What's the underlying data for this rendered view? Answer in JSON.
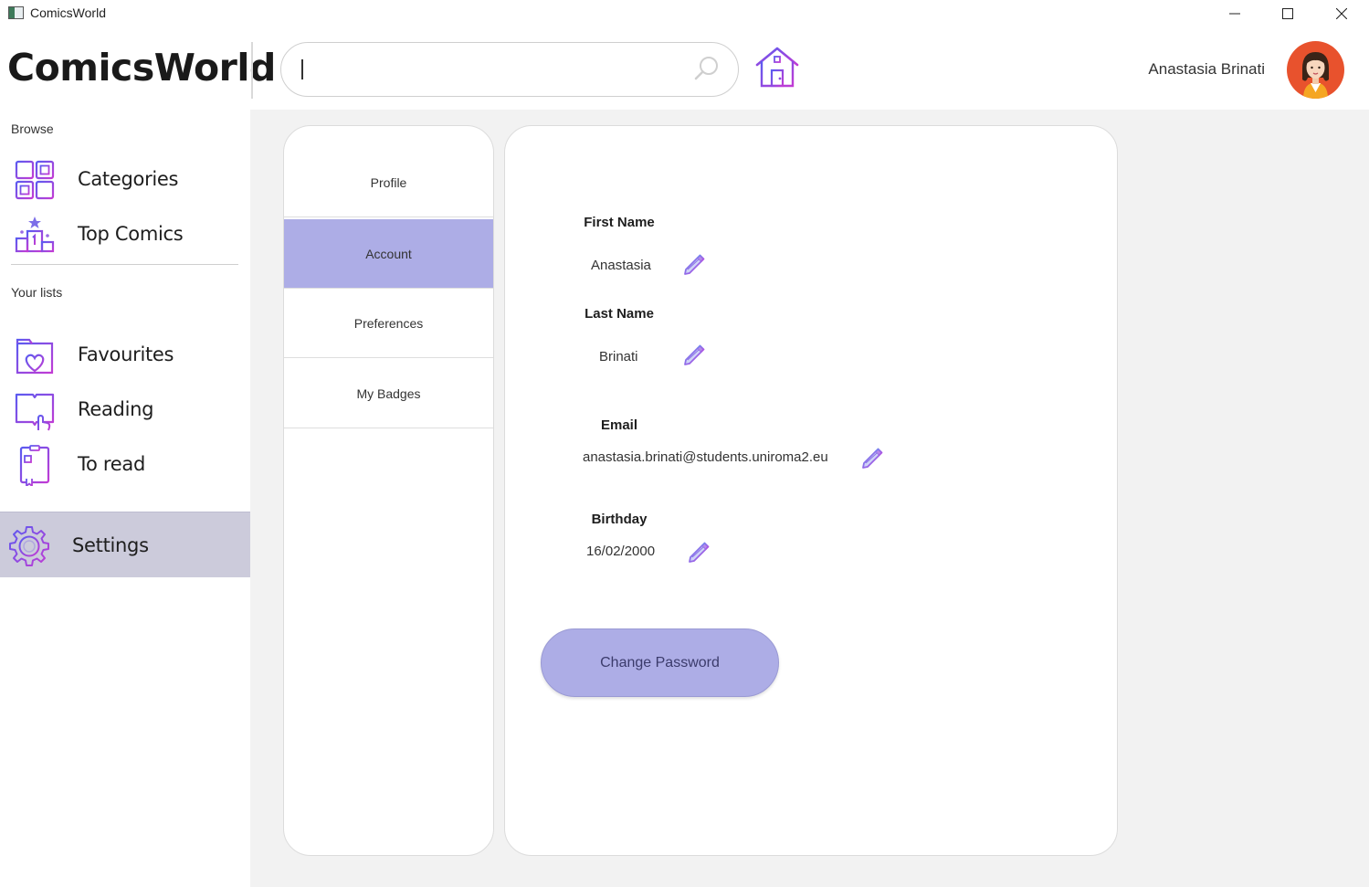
{
  "window": {
    "title": "ComicsWorld"
  },
  "header": {
    "brand": "ComicsWorld",
    "search": {
      "value": "",
      "placeholder": ""
    },
    "user_name": "Anastasia Brinati"
  },
  "sidebar": {
    "browse_label": "Browse",
    "browse_items": [
      {
        "label": "Categories",
        "icon": "categories-icon"
      },
      {
        "label": "Top Comics",
        "icon": "podium-icon"
      }
    ],
    "lists_label": "Your lists",
    "list_items": [
      {
        "label": "Favourites",
        "icon": "heart-folder-icon"
      },
      {
        "label": "Reading",
        "icon": "open-book-icon"
      },
      {
        "label": "To read",
        "icon": "notebook-icon"
      }
    ],
    "settings": {
      "label": "Settings",
      "icon": "gear-icon",
      "selected": true
    }
  },
  "settings_tabs": [
    {
      "label": "Profile",
      "active": false
    },
    {
      "label": "Account",
      "active": true
    },
    {
      "label": "Preferences",
      "active": false
    },
    {
      "label": "My Badges",
      "active": false
    }
  ],
  "account": {
    "first_name": {
      "label": "First Name",
      "value": "Anastasia"
    },
    "last_name": {
      "label": "Last Name",
      "value": "Brinati"
    },
    "email": {
      "label": "Email",
      "value": "anastasia.brinati@students.uniroma2.eu"
    },
    "birthday": {
      "label": "Birthday",
      "value": "16/02/2000"
    },
    "change_password_label": "Change Password"
  },
  "colors": {
    "accent": "#adade6",
    "sidebar_selected": "#cccbdb",
    "main_background": "#f2f2f2",
    "icon_gradient_start": "#5b5bf0",
    "icon_gradient_end": "#c23bd4",
    "avatar_background": "#e8522d"
  }
}
